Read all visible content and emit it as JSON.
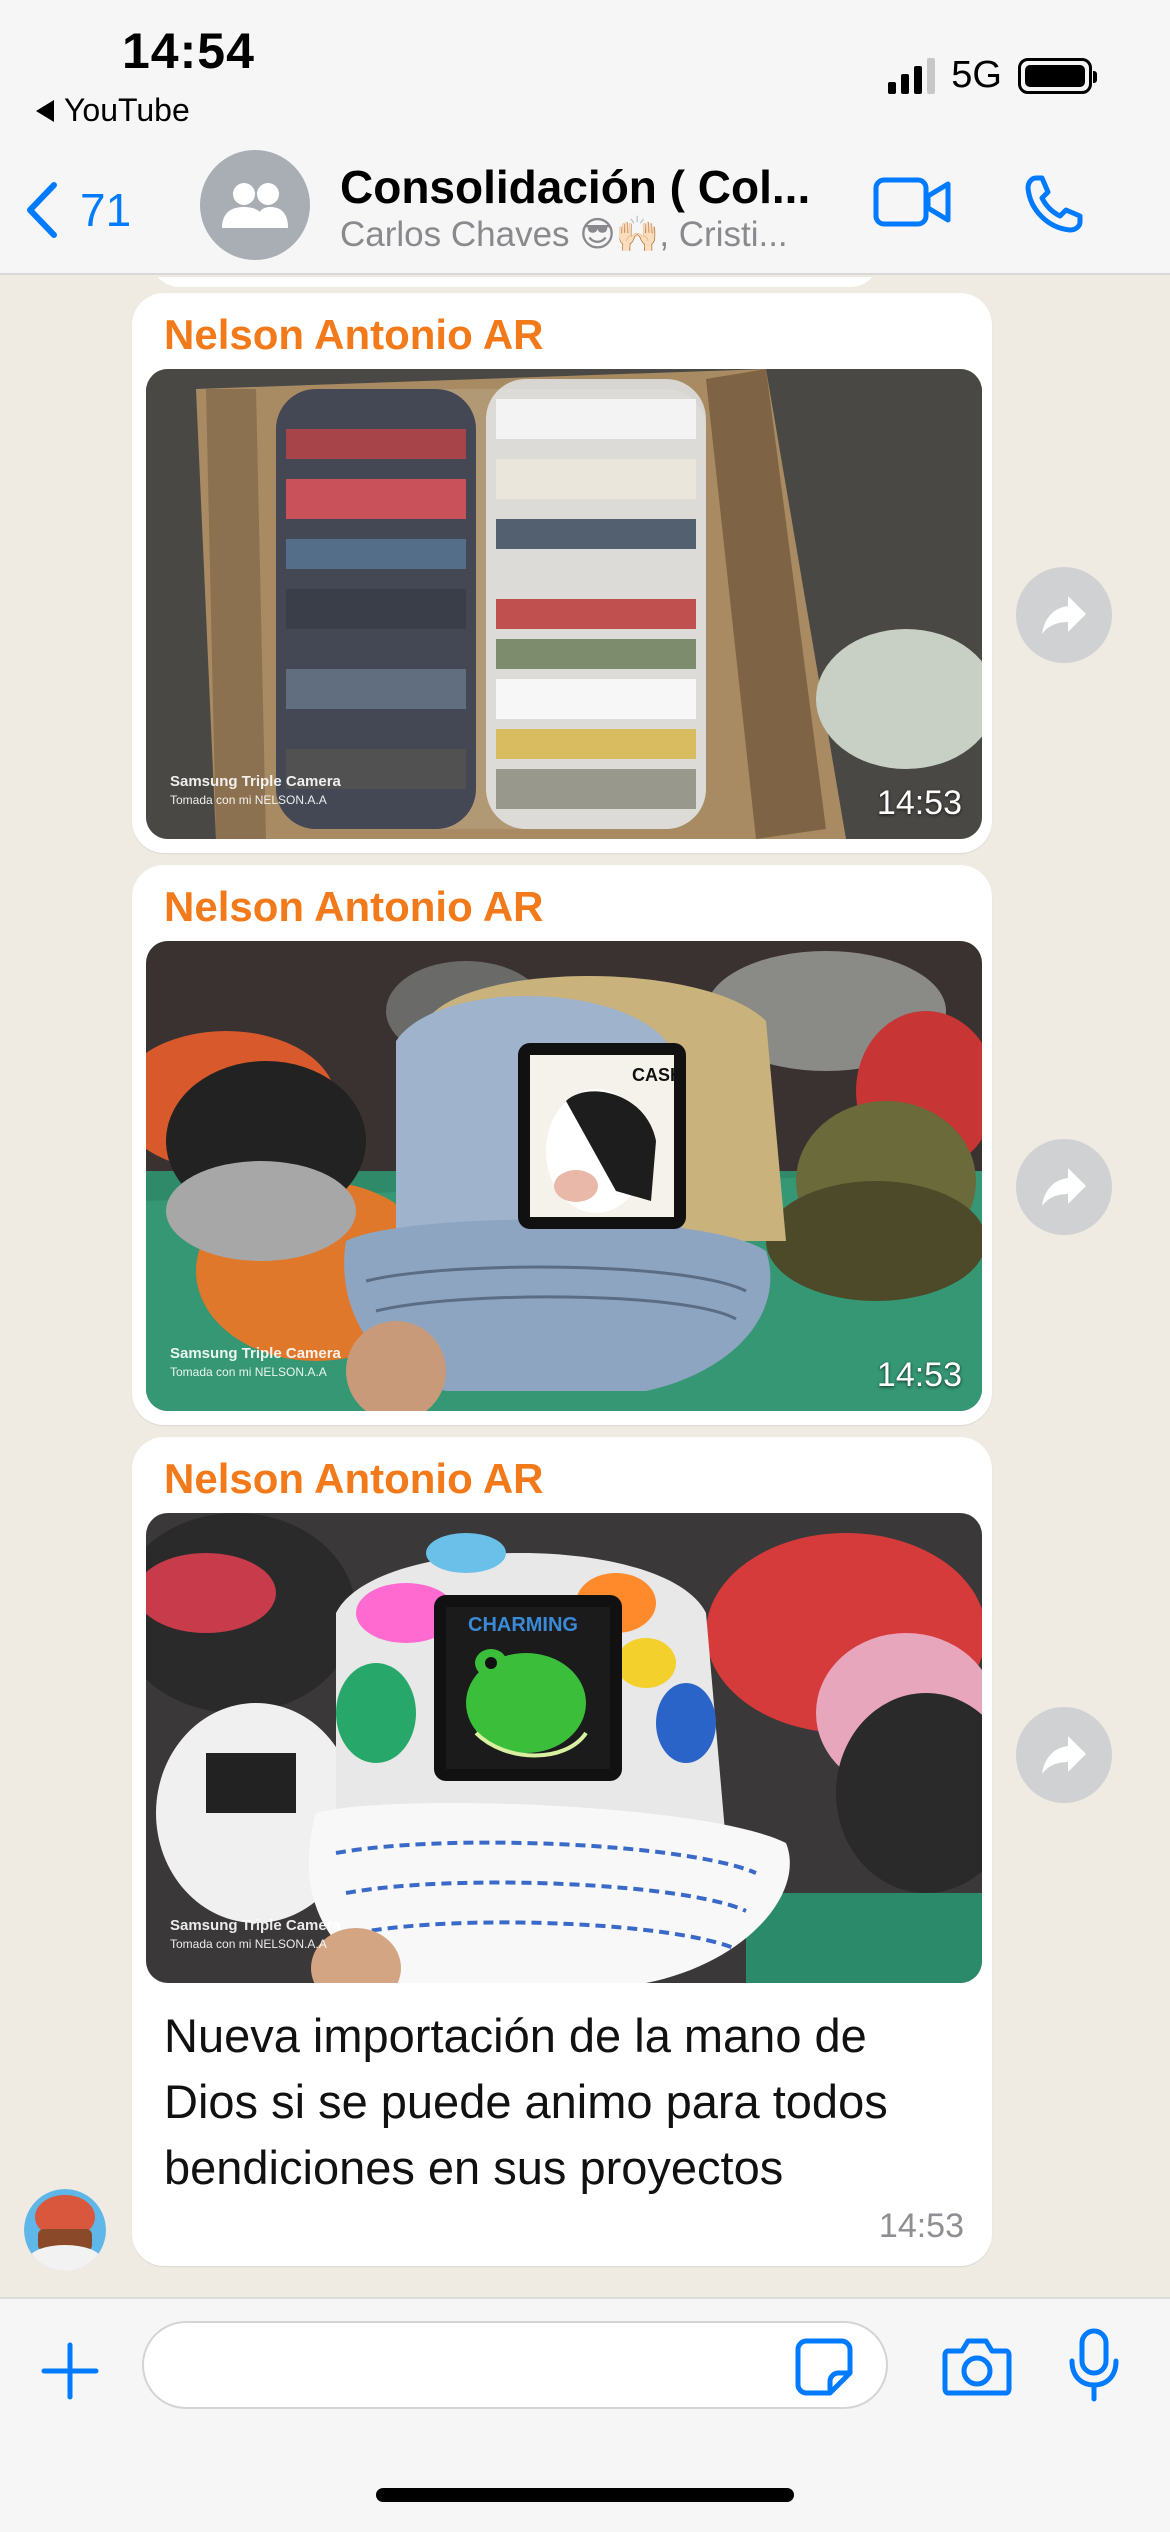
{
  "status_bar": {
    "time": "14:54",
    "back_app": "YouTube",
    "network": "5G"
  },
  "header": {
    "back_count": "71",
    "title": "Consolidación ( Col...",
    "subtitle": "Carlos Chaves 😎🙌🏻, Cristi...",
    "icons": [
      "chevron-left-icon",
      "group-icon",
      "video-call-icon",
      "phone-icon"
    ]
  },
  "messages": [
    {
      "sender": "Nelson Antonio AR",
      "photo_desc": "box of caps",
      "watermark_line1": "Samsung Triple Camera",
      "watermark_line2": "Tomada con mi NELSON.A.A",
      "time": "14:53"
    },
    {
      "sender": "Nelson Antonio AR",
      "photo_desc": "cow patch cap",
      "watermark_line1": "Samsung Triple Camera",
      "watermark_line2": "Tomada con mi NELSON.A.A",
      "patch_text": "CASH",
      "time": "14:53"
    },
    {
      "sender": "Nelson Antonio AR",
      "photo_desc": "frog patch cap",
      "watermark_line1": "Samsung Triple Camera",
      "watermark_line2": "Tomada con mi NELSON.A.A",
      "patch_text": "CHARMING",
      "caption": "Nueva importación de la mano de Dios si se puede animo para todos bendiciones en sus proyectos",
      "time": "14:53"
    }
  ],
  "input": {
    "placeholder": "",
    "icons": [
      "plus-icon",
      "sticker-icon",
      "camera-icon",
      "microphone-icon"
    ]
  },
  "colors": {
    "accent": "#007aff",
    "sender": "#f27a1a",
    "chat_bg": "#efeae2",
    "bubble": "#ffffff"
  }
}
